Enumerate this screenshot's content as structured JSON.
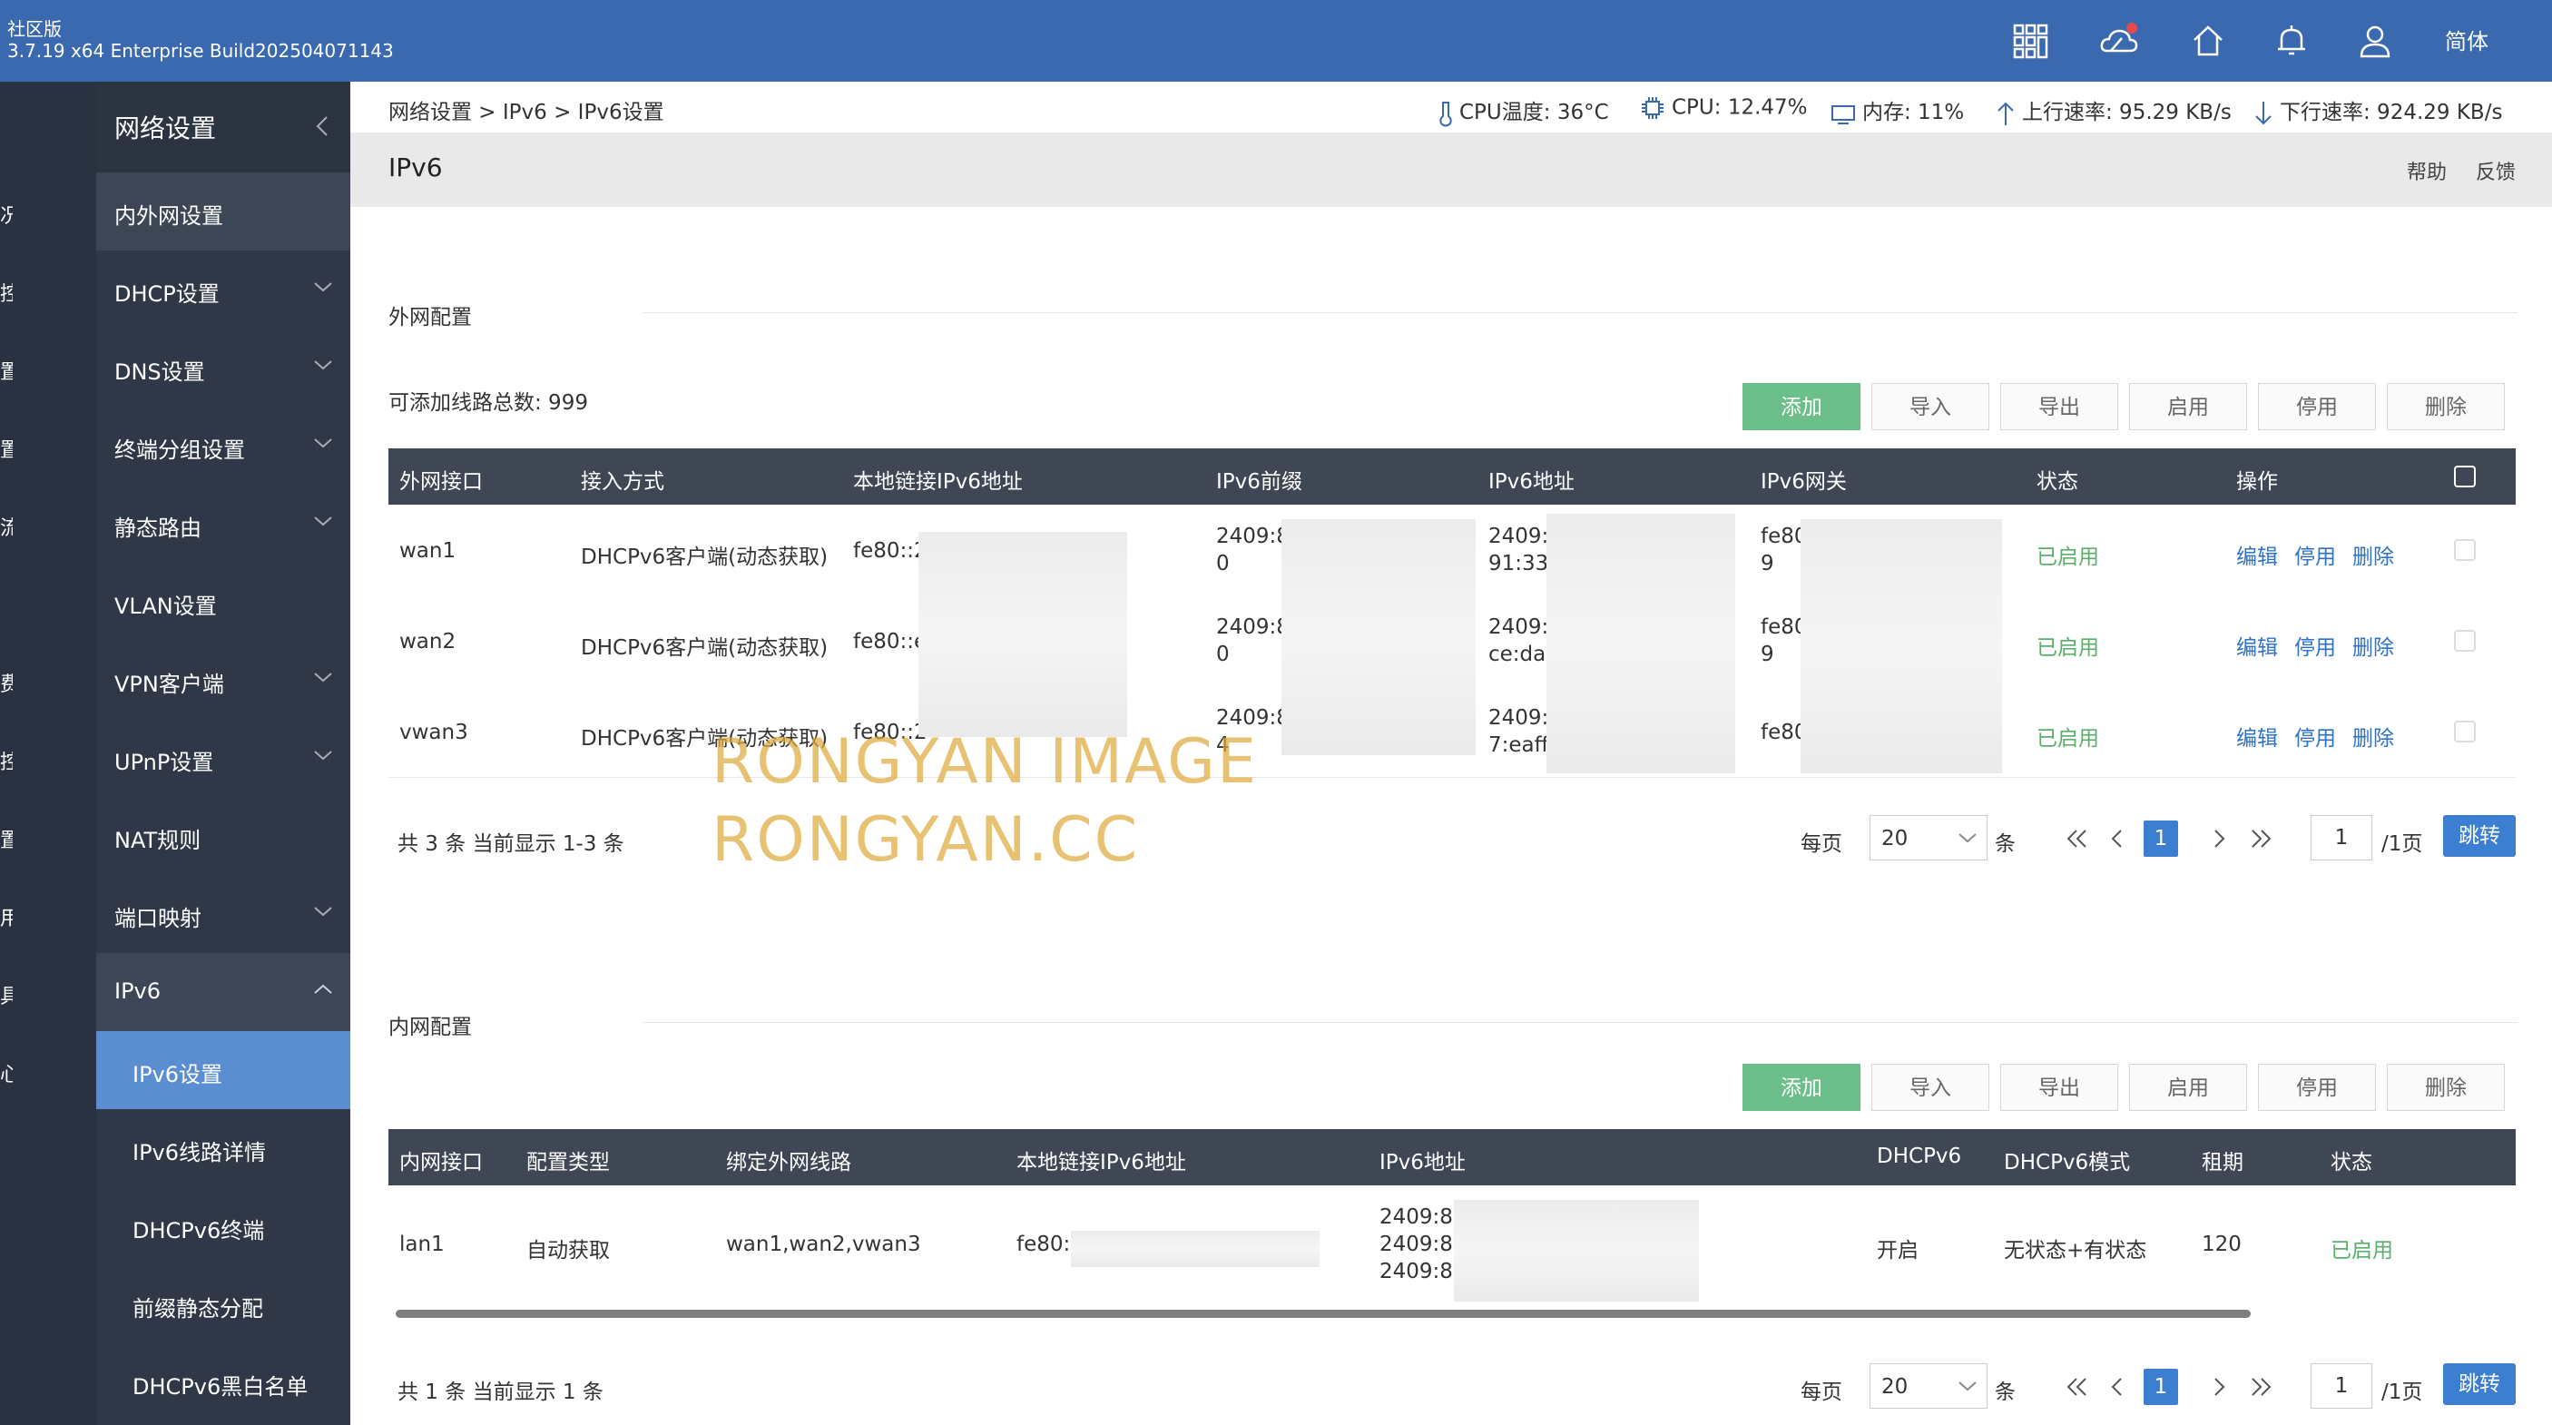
{
  "header": {
    "edition": "社区版",
    "build": "3.7.19 x64 Enterprise Build202504071143",
    "language": "简体",
    "icons": [
      "apps-icon",
      "cloud-icon",
      "home-icon",
      "bell-icon",
      "user-icon"
    ],
    "accent": "#3a69b0"
  },
  "rail": {
    "items": [
      "况",
      "控",
      "置",
      "置",
      "流",
      "费",
      "控",
      "置",
      "用",
      "具",
      "心"
    ]
  },
  "sidebar": {
    "title": "网络设置",
    "items": [
      {
        "label": "内外网设置",
        "chevron": false
      },
      {
        "label": "DHCP设置",
        "chevron": true
      },
      {
        "label": "DNS设置",
        "chevron": true
      },
      {
        "label": "终端分组设置",
        "chevron": true
      },
      {
        "label": "静态路由",
        "chevron": true
      },
      {
        "label": "VLAN设置",
        "chevron": false
      },
      {
        "label": "VPN客户端",
        "chevron": true
      },
      {
        "label": "UPnP设置",
        "chevron": true
      },
      {
        "label": "NAT规则",
        "chevron": false
      },
      {
        "label": "端口映射",
        "chevron": true
      },
      {
        "label": "IPv6",
        "chevron": true
      }
    ],
    "subitems": [
      "IPv6设置",
      "IPv6线路详情",
      "DHCPv6终端",
      "前缀静态分配",
      "DHCPv6黑白名单"
    ]
  },
  "status": {
    "breadcrumb": "网络设置 > IPv6 > IPv6设置",
    "cpu_temp": "CPU温度: 36°C",
    "cpu": "CPU: 12.47%",
    "mem": "内存: 11%",
    "up": "上行速率: 95.29 KB/s",
    "down": "下行速率: 924.29 KB/s"
  },
  "page": {
    "title": "IPv6",
    "help": "帮助",
    "feedback": "反馈"
  },
  "wan": {
    "section": "外网配置",
    "count_text": "可添加线路总数: 999",
    "buttons": [
      "添加",
      "导入",
      "导出",
      "启用",
      "停用",
      "删除"
    ],
    "columns": [
      "外网接口",
      "接入方式",
      "本地链接IPv6地址",
      "IPv6前缀",
      "IPv6地址",
      "IPv6网关",
      "状态",
      "操作"
    ],
    "rows": [
      {
        "iface": "wan1",
        "mode": "DHCPv6客户端(动态获取)",
        "link": "fe80::2",
        "prefix1": "2409:8",
        "prefix2": "0",
        "addr1": "2409:8",
        "addr2": "91:33c",
        "gw1": "fe80",
        "gw2": "9",
        "status": "已启用"
      },
      {
        "iface": "wan2",
        "mode": "DHCPv6客户端(动态获取)",
        "link": "fe80::e",
        "prefix1": "2409:8",
        "prefix2": "0",
        "addr1": "2409:8",
        "addr2": "ce:da2",
        "gw1": "fe80",
        "gw2": "9",
        "status": "已启用"
      },
      {
        "iface": "vwan3",
        "mode": "DHCPv6客户端(动态获取)",
        "link": "fe80::2",
        "prefix1": "2409:8",
        "prefix2": "4",
        "addr1": "2409:8",
        "addr2": "7:eaff",
        "gw1": "fe80",
        "gw2": "",
        "status": "已启用"
      }
    ],
    "actions": [
      "编辑",
      "停用",
      "删除"
    ],
    "summary": "共 3 条 当前显示 1-3 条"
  },
  "lan": {
    "section": "内网配置",
    "buttons": [
      "添加",
      "导入",
      "导出",
      "启用",
      "停用",
      "删除"
    ],
    "columns": [
      "内网接口",
      "配置类型",
      "绑定外网线路",
      "本地链接IPv6地址",
      "IPv6地址",
      "DHCPv6",
      "DHCPv6模式",
      "租期",
      "状态"
    ],
    "rows": [
      {
        "iface": "lan1",
        "type": "自动获取",
        "bound": "wan1,wan2,vwan3",
        "link": "fe80:",
        "addr1": "2409:8a",
        "addr2": "2409:8a",
        "addr3": "2409:8a",
        "dhcp": "开启",
        "dhcp_mode": "无状态+有状态",
        "lease": "120",
        "status": "已启用"
      }
    ],
    "summary": "共 1 条 当前显示 1 条"
  },
  "pager": {
    "per_page_label": "每页",
    "per_page_value": "20",
    "unit": "条",
    "current_page": "1",
    "page_input": "1",
    "total_pages": "/1页",
    "jump": "跳转"
  },
  "watermark": [
    "RONGYAN IMAGE",
    "RONGYAN.CC"
  ]
}
